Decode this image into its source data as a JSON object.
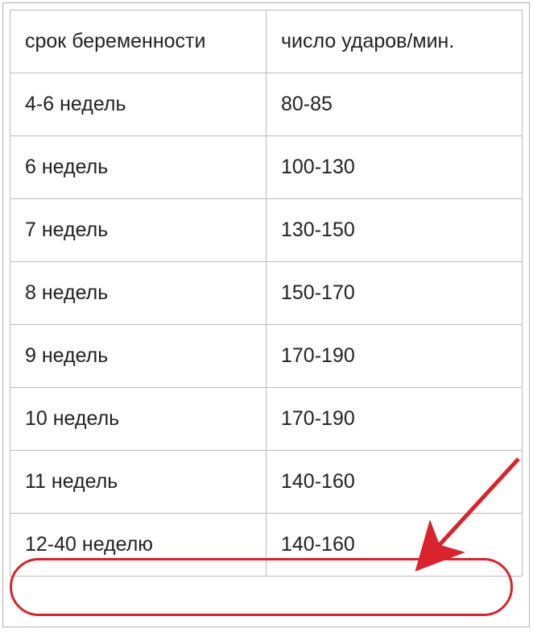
{
  "table": {
    "headers": {
      "col1": "срок беременности",
      "col2": "число ударов/мин."
    },
    "rows": [
      {
        "term": "4-6 недель",
        "bpm": "80-85"
      },
      {
        "term": "6 недель",
        "bpm": "100-130"
      },
      {
        "term": "7 недель",
        "bpm": "130-150"
      },
      {
        "term": "8 недель",
        "bpm": "150-170"
      },
      {
        "term": "9 недель",
        "bpm": "170-190"
      },
      {
        "term": "10 недель",
        "bpm": "170-190"
      },
      {
        "term": "11 недель",
        "bpm": "140-160"
      },
      {
        "term": "12-40 неделю",
        "bpm": "140-160"
      }
    ]
  },
  "highlight": {
    "row_index": 7,
    "color": "#d9232e"
  }
}
